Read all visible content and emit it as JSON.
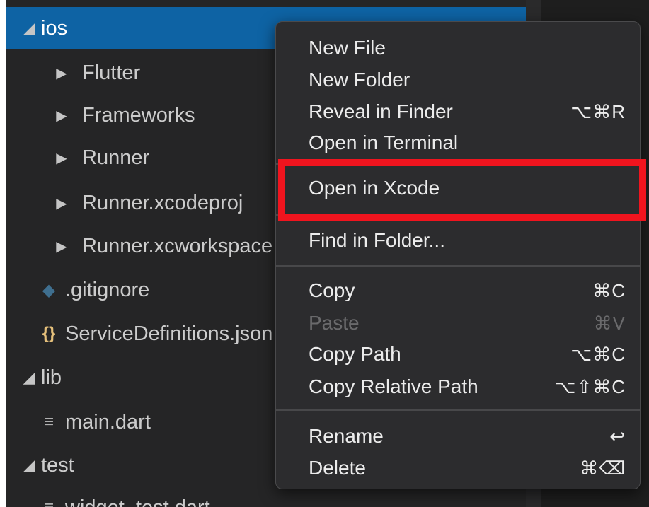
{
  "tree": [
    {
      "label": "ios",
      "type": "folder-open",
      "selected": true
    },
    {
      "label": "Flutter",
      "type": "folder-closed"
    },
    {
      "label": "Frameworks",
      "type": "folder-closed"
    },
    {
      "label": "Runner",
      "type": "folder-closed"
    },
    {
      "label": "Runner.xcodeproj",
      "type": "folder-closed"
    },
    {
      "label": "Runner.xcworkspace",
      "type": "folder-closed"
    },
    {
      "label": ".gitignore",
      "type": "file",
      "icon": "diamond-icon"
    },
    {
      "label": "ServiceDefinitions.json",
      "type": "file",
      "icon": "json-braces-icon"
    },
    {
      "label": "lib",
      "type": "folder-open"
    },
    {
      "label": "main.dart",
      "type": "file",
      "icon": "lines-file-icon"
    },
    {
      "label": "test",
      "type": "folder-open"
    },
    {
      "label": "widget_test.dart",
      "type": "file",
      "icon": "lines-file-icon"
    }
  ],
  "menu": {
    "new_file": {
      "label": "New File"
    },
    "new_folder": {
      "label": "New Folder"
    },
    "reveal_in_finder": {
      "label": "Reveal in Finder",
      "shortcut": "⌥⌘R"
    },
    "open_in_terminal": {
      "label": "Open in Terminal"
    },
    "open_in_xcode": {
      "label": "Open in Xcode"
    },
    "find_in_folder": {
      "label": "Find in Folder..."
    },
    "copy": {
      "label": "Copy",
      "shortcut": "⌘C"
    },
    "paste": {
      "label": "Paste",
      "shortcut": "⌘V",
      "disabled": true
    },
    "copy_path": {
      "label": "Copy Path",
      "shortcut": "⌥⌘C"
    },
    "copy_relative_path": {
      "label": "Copy Relative Path",
      "shortcut": "⌥⇧⌘C"
    },
    "rename": {
      "label": "Rename",
      "shortcut": "↩"
    },
    "delete": {
      "label": "Delete",
      "shortcut": "⌘⌫"
    }
  },
  "colors": {
    "selection": "#0e63a4",
    "highlight": "#f0141e",
    "json_icon": "#e5c07b",
    "gitignore_icon": "#3f6f8f"
  }
}
